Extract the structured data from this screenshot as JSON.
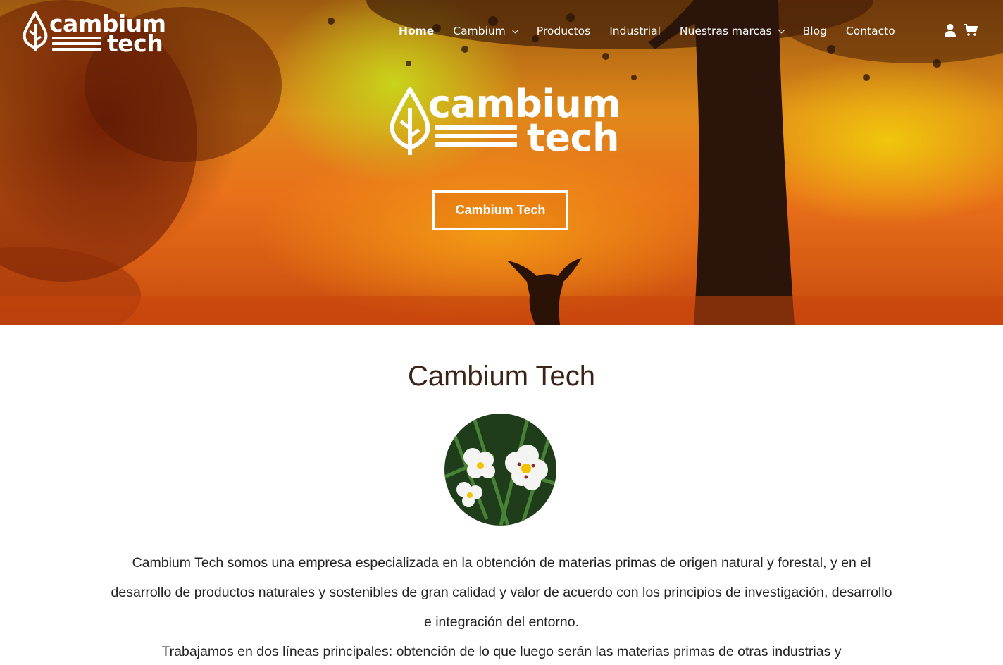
{
  "brand": {
    "line1": "cambium",
    "line2": "tech"
  },
  "nav": {
    "items": [
      {
        "label": "Home",
        "active": true,
        "dropdown": false
      },
      {
        "label": "Cambium",
        "active": false,
        "dropdown": true
      },
      {
        "label": "Productos",
        "active": false,
        "dropdown": false
      },
      {
        "label": "Industrial",
        "active": false,
        "dropdown": false
      },
      {
        "label": "Nuestras marcas",
        "active": false,
        "dropdown": true
      },
      {
        "label": "Blog",
        "active": false,
        "dropdown": false
      },
      {
        "label": "Contacto",
        "active": false,
        "dropdown": false
      }
    ],
    "icons": [
      "user-icon",
      "cart-icon"
    ]
  },
  "hero": {
    "logo_line1": "cambium",
    "logo_line2": "tech",
    "button_label": "Cambium Tech"
  },
  "main": {
    "title": "Cambium Tech",
    "paragraph1": "Cambium Tech somos una empresa especializada en la obtención de materias primas de origen natural y forestal, y en el desarrollo de productos naturales y sostenibles de gran calidad y valor de acuerdo con los principios de investigación, desarrollo e integración del entorno.",
    "paragraph2": "Trabajamos en dos líneas principales: obtención de lo que luego serán las materias primas de otras industrias y"
  },
  "colors": {
    "title": "#3b2317",
    "hero_orange": "#e9711a",
    "white": "#ffffff"
  }
}
